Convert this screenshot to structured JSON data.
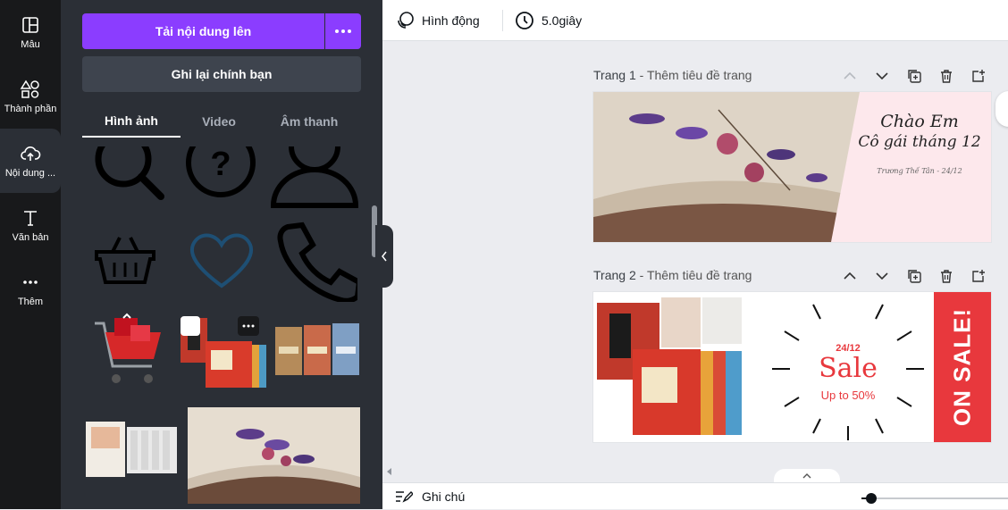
{
  "rail": {
    "items": [
      {
        "label": "Mẫu",
        "icon": "template-icon"
      },
      {
        "label": "Thành phần",
        "icon": "elements-icon"
      },
      {
        "label": "Nội dung ...",
        "icon": "upload-cloud-icon"
      },
      {
        "label": "Văn bản",
        "icon": "text-icon"
      },
      {
        "label": "Thêm",
        "icon": "more-dots-icon"
      }
    ]
  },
  "panel": {
    "upload_label": "Tải nội dung lên",
    "record_label": "Ghi lại chính bạn",
    "tabs": [
      "Hình ảnh",
      "Video",
      "Âm thanh"
    ],
    "active_tab": "Hình ảnh"
  },
  "topbar": {
    "animate_label": "Hình động",
    "duration_label": "5.0giây"
  },
  "pages": [
    {
      "number": "Trang 1",
      "title_placeholder": "Thêm tiêu đề trang",
      "design": {
        "line1": "Chào Em",
        "line2": "Cô gái tháng 12",
        "byline": "Trương Thế Tân - 24/12"
      }
    },
    {
      "number": "Trang 2",
      "title_placeholder": "Thêm tiêu đề trang",
      "design": {
        "date": "24/12",
        "sale": "Sale",
        "discount": "Up to 50%",
        "banner": "ON SALE!"
      }
    }
  ],
  "bottombar": {
    "notes_label": "Ghi chú"
  },
  "colors": {
    "accent": "#8b3dff",
    "sale_red": "#e8383d",
    "panel_bg": "#2b2f36",
    "rail_bg": "#18191b"
  }
}
